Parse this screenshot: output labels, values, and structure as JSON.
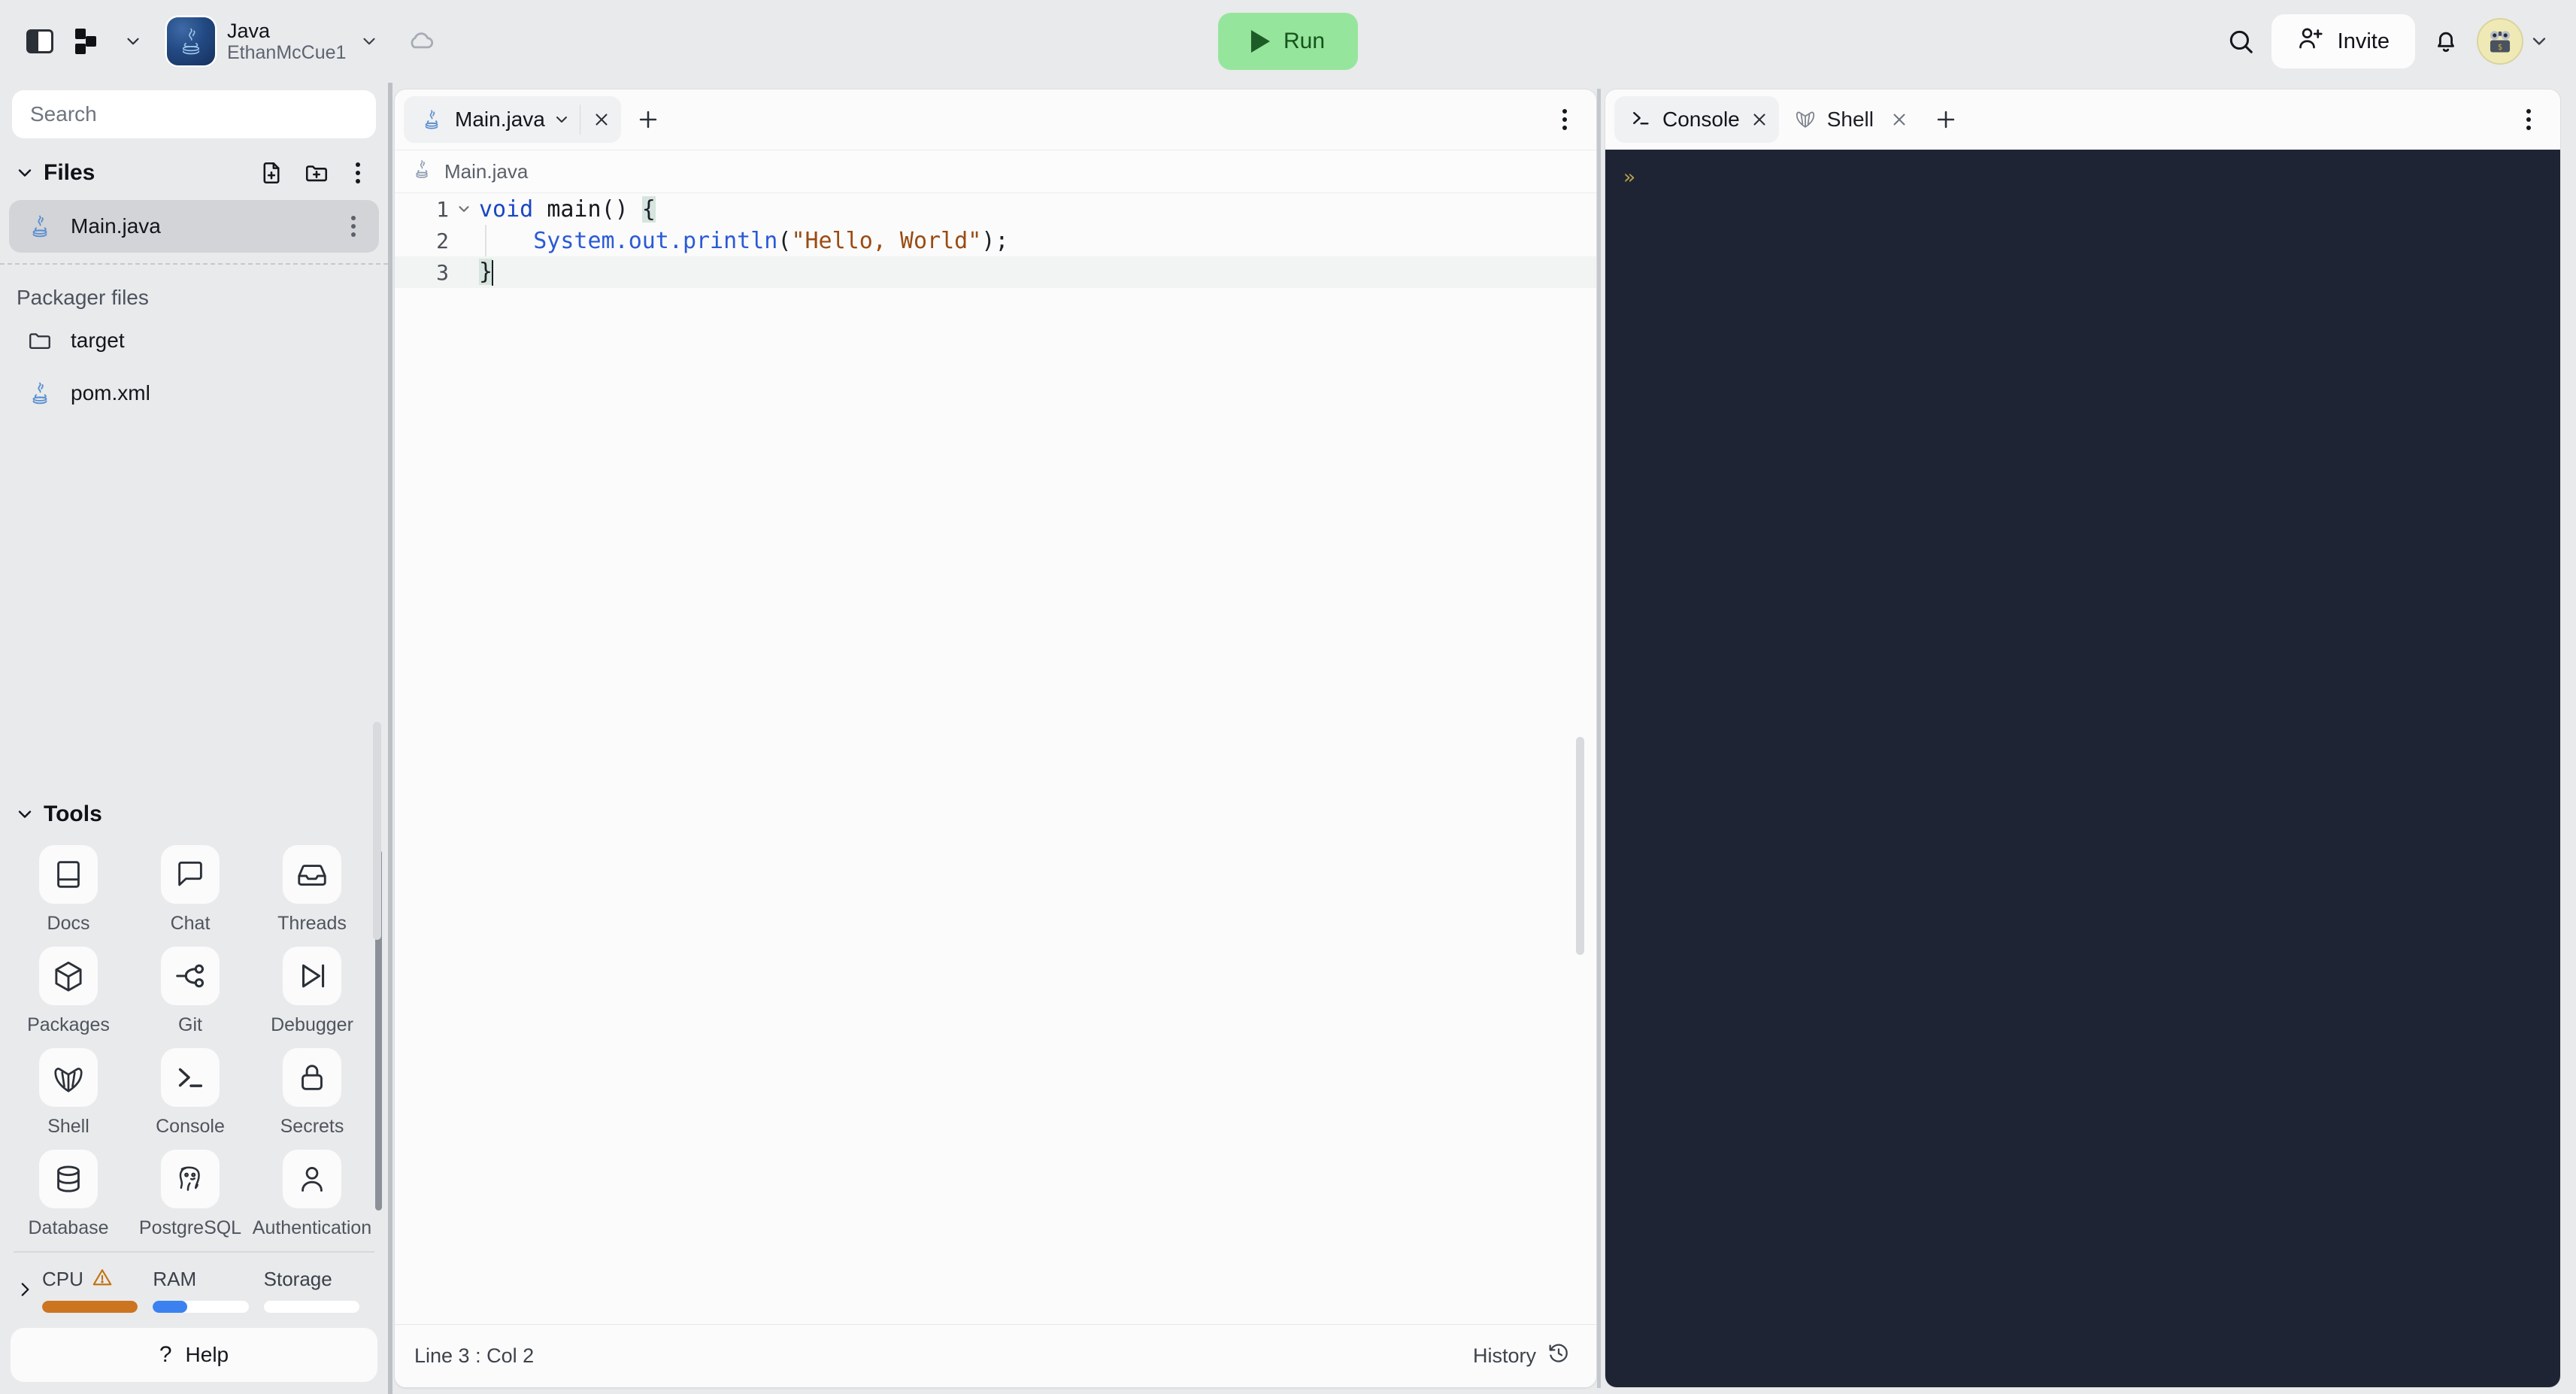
{
  "topbar": {
    "panel_toggle_icon": "panel-left-icon",
    "repl_switcher_icon": "replit-logo-icon",
    "repl_switcher_chevron": "chevron-down-icon",
    "project_icon": "java-logo-icon",
    "project_name": "Java",
    "project_owner": "EthanMcCue1",
    "project_chevron": "chevron-down-icon",
    "cloud_icon": "cloud-icon",
    "run_label": "Run",
    "run_icon": "play-icon",
    "run_bg": "#96e59c",
    "run_fg": "#16531d",
    "search_icon": "search-icon",
    "invite_label": "Invite",
    "invite_icon": "user-plus-icon",
    "notifications_icon": "bell-icon",
    "avatar_icon": "user-avatar-icon",
    "account_chevron": "chevron-down-icon"
  },
  "sidebar": {
    "search": {
      "placeholder": "Search",
      "value": ""
    },
    "files": {
      "chevron": "chevron-down-icon",
      "title": "Files",
      "new_file_icon": "file-plus-icon",
      "new_folder_icon": "folder-plus-icon",
      "menu_icon": "kebab-menu-icon",
      "items": [
        {
          "name": "Main.java",
          "icon": "java-file-icon",
          "active": true
        }
      ]
    },
    "packager": {
      "label": "Packager files",
      "items": [
        {
          "name": "target",
          "icon": "folder-icon"
        },
        {
          "name": "pom.xml",
          "icon": "java-file-icon"
        }
      ]
    },
    "tools": {
      "chevron": "chevron-down-icon",
      "title": "Tools",
      "items": [
        {
          "label": "Docs",
          "icon": "book-icon"
        },
        {
          "label": "Chat",
          "icon": "chat-bubble-icon"
        },
        {
          "label": "Threads",
          "icon": "inbox-icon"
        },
        {
          "label": "Packages",
          "icon": "cube-icon"
        },
        {
          "label": "Git",
          "icon": "git-branch-icon"
        },
        {
          "label": "Debugger",
          "icon": "step-over-icon"
        },
        {
          "label": "Shell",
          "icon": "shell-icon"
        },
        {
          "label": "Console",
          "icon": "terminal-icon"
        },
        {
          "label": "Secrets",
          "icon": "lock-icon"
        },
        {
          "label": "Database",
          "icon": "database-icon"
        },
        {
          "label": "PostgreSQL",
          "icon": "postgres-elephant-icon"
        },
        {
          "label": "Authentication",
          "icon": "person-icon"
        }
      ]
    },
    "resources": {
      "expand_icon": "chevron-right-icon",
      "items": [
        {
          "label": "CPU",
          "percent": 100,
          "color": "#cc7420",
          "warning": true,
          "warning_icon": "warning-triangle-icon"
        },
        {
          "label": "RAM",
          "percent": 36,
          "color": "#3b82f0",
          "warning": false
        },
        {
          "label": "Storage",
          "percent": 0,
          "color": "#3b82f0",
          "warning": false
        }
      ]
    },
    "help": {
      "label": "Help",
      "icon": "question-mark-icon"
    }
  },
  "editor": {
    "tab": {
      "name": "Main.java",
      "icon": "java-file-icon",
      "chevron": "chevron-down-icon",
      "close_icon": "close-icon"
    },
    "add_tab_icon": "plus-icon",
    "pane_menu_icon": "kebab-menu-icon",
    "breadcrumb": {
      "icon": "java-file-icon",
      "text": "Main.java"
    },
    "code": {
      "lines": [
        {
          "num": "1",
          "fold": "chevron-down-icon"
        },
        {
          "num": "2",
          "fold": ""
        },
        {
          "num": "3",
          "fold": "",
          "active": true
        }
      ],
      "line1": {
        "kw": "void",
        "sp1": " ",
        "fn": "main",
        "parens": "()",
        "sp2": " ",
        "brace": "{"
      },
      "line2": {
        "cls": "System",
        "dot1": ".",
        "field": "out",
        "dot2": ".",
        "mth": "println",
        "open": "(",
        "str": "\"Hello, World\"",
        "close": ");"
      },
      "line3": {
        "brace": "}"
      }
    },
    "status": {
      "position": "Line 3 : Col 2",
      "history_label": "History",
      "history_icon": "history-clock-icon"
    }
  },
  "console": {
    "tabs": [
      {
        "label": "Console",
        "icon": "terminal-icon",
        "chevron": "chevron-down-icon",
        "close_icon": "close-icon",
        "active": true
      },
      {
        "label": "Shell",
        "icon": "shell-icon",
        "close_icon": "close-icon",
        "active": false
      }
    ],
    "add_tab_icon": "plus-icon",
    "pane_menu_icon": "kebab-menu-icon",
    "terminal": {
      "prompt": "»",
      "background": "#1e2433",
      "prompt_color": "#b9a34a"
    }
  }
}
